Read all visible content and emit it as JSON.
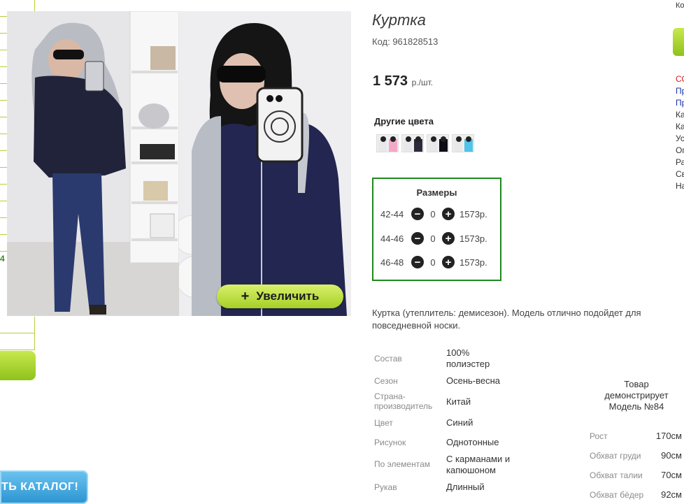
{
  "left_sidebar": {
    "visible_number": "4",
    "catalog_button": "ТЬ КАТАЛОГ!"
  },
  "gallery": {
    "zoom_label": "Увеличить",
    "zoom_icon": "plus-icon"
  },
  "product": {
    "title": "Куртка",
    "code": "Код: 961828513",
    "price": "1 573",
    "price_unit": "р./шт.",
    "other_colors_title": "Другие цвета",
    "swatches": [
      {
        "color": "#f4a8c8"
      },
      {
        "color": "#2a2a3a"
      },
      {
        "color": "#0d0d14"
      },
      {
        "color": "#4fc3e8"
      }
    ],
    "sizes_title": "Размеры",
    "sizes": [
      {
        "label": "42-44",
        "qty": "0",
        "price": "1573р."
      },
      {
        "label": "44-46",
        "qty": "0",
        "price": "1573р."
      },
      {
        "label": "46-48",
        "qty": "0",
        "price": "1573р."
      }
    ],
    "description": "Куртка (утеплитель: демисезон). Модель отлично подойдет для повседневной носки.",
    "specs": [
      {
        "label": "Состав",
        "value": "100% полиэстер"
      },
      {
        "label": "Сезон",
        "value": "Осень-весна"
      },
      {
        "label": "Страна-производитель",
        "value": "Китай"
      },
      {
        "label": "Цвет",
        "value": "Синий"
      },
      {
        "label": "Рисунок",
        "value": "Однотонные"
      },
      {
        "label": "По элементам",
        "value": "С карманами и капюшоном"
      },
      {
        "label": "Рукав",
        "value": "Длинный"
      }
    ]
  },
  "model": {
    "caption": "Товар демонстрирует Модель №84",
    "measures": [
      {
        "label": "Рост",
        "value": "170см"
      },
      {
        "label": "Обхват груди",
        "value": "90см"
      },
      {
        "label": "Обхват талии",
        "value": "70см"
      },
      {
        "label": "Обхват бёдер",
        "value": "92см"
      }
    ]
  },
  "right_sidebar": {
    "top_text": "Ко",
    "links": [
      {
        "text": "СО",
        "color": "#d02020"
      },
      {
        "text": "Пр",
        "color": "#1a33a8"
      },
      {
        "text": "Пр",
        "color": "#1a33a8"
      },
      {
        "text": "Ка",
        "color": "#333333"
      },
      {
        "text": "Ка",
        "color": "#333333"
      },
      {
        "text": "Ус",
        "color": "#333333"
      },
      {
        "text": "Оп",
        "color": "#333333"
      },
      {
        "text": "Ра",
        "color": "#333333"
      },
      {
        "text": "Св",
        "color": "#333333"
      },
      {
        "text": "На",
        "color": "#333333"
      }
    ]
  }
}
